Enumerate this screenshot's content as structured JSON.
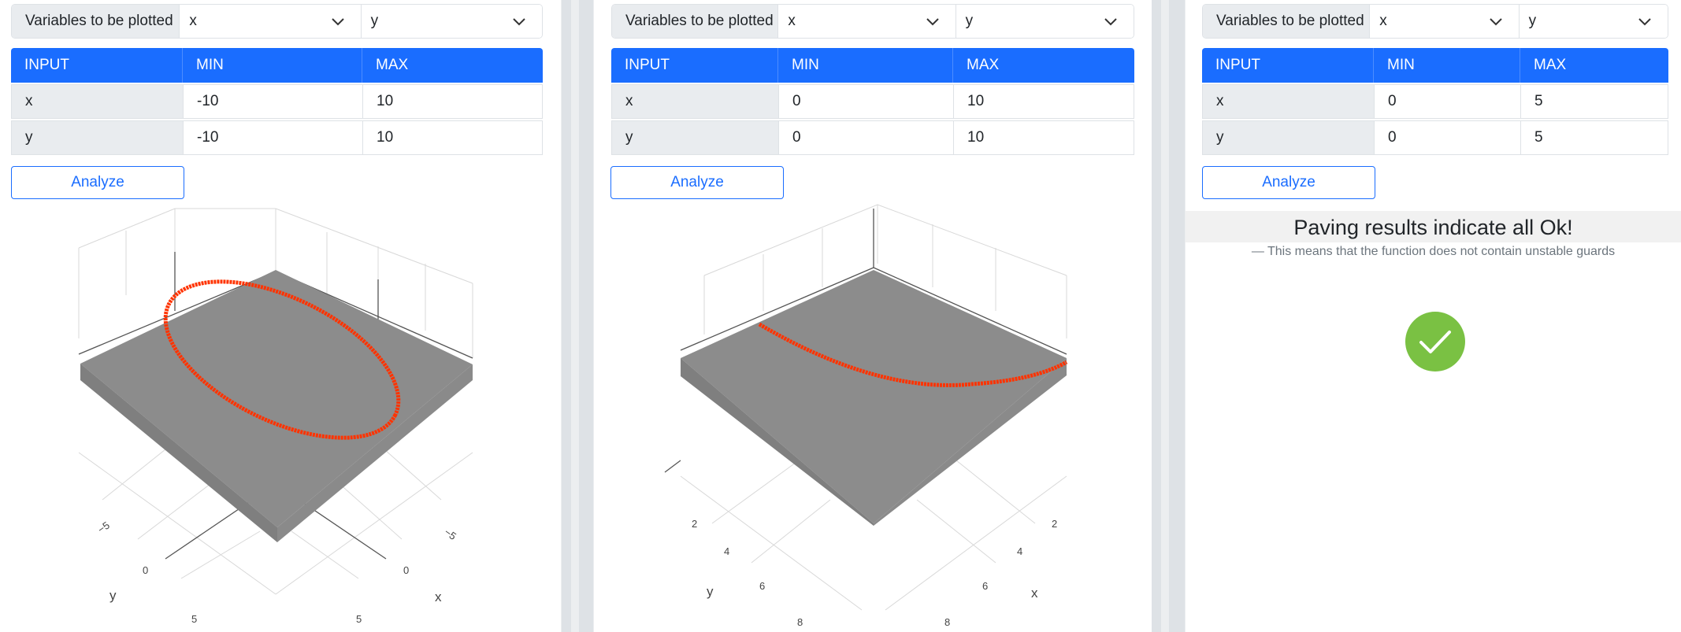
{
  "panels": [
    {
      "var_label": "Variables to be plotted",
      "sel_x": "x",
      "sel_y": "y",
      "headers": [
        "INPUT",
        "MIN",
        "MAX"
      ],
      "rows": [
        [
          "x",
          "-10",
          "10"
        ],
        [
          "y",
          "-10",
          "10"
        ]
      ],
      "analyze": "Analyze",
      "plot": {
        "y_title": "y",
        "x_title": "x",
        "y_ticks": [
          "−5",
          "0",
          "5"
        ],
        "x_ticks": [
          "−5",
          "0",
          "5"
        ]
      }
    },
    {
      "var_label": "Variables to be plotted",
      "sel_x": "x",
      "sel_y": "y",
      "headers": [
        "INPUT",
        "MIN",
        "MAX"
      ],
      "rows": [
        [
          "x",
          "0",
          "10"
        ],
        [
          "y",
          "0",
          "10"
        ]
      ],
      "analyze": "Analyze",
      "plot": {
        "y_title": "y",
        "x_title": "x",
        "y_ticks": [
          "2",
          "4",
          "6",
          "8"
        ],
        "x_ticks": [
          "2",
          "4",
          "6",
          "8"
        ]
      }
    },
    {
      "var_label": "Variables to be plotted",
      "sel_x": "x",
      "sel_y": "y",
      "headers": [
        "INPUT",
        "MIN",
        "MAX"
      ],
      "rows": [
        [
          "x",
          "0",
          "5"
        ],
        [
          "y",
          "0",
          "5"
        ]
      ],
      "analyze": "Analyze",
      "result_title": "Paving results indicate all Ok!",
      "result_subtitle": "— This means that the function does not contain unstable guards"
    }
  ],
  "colors": {
    "accent": "#1a6dff",
    "surface": "#8c8c8c",
    "curve": "#ff3300",
    "ok_green": "#7ac143"
  },
  "icons": [
    "chevron-down-icon",
    "checkmark-icon"
  ]
}
